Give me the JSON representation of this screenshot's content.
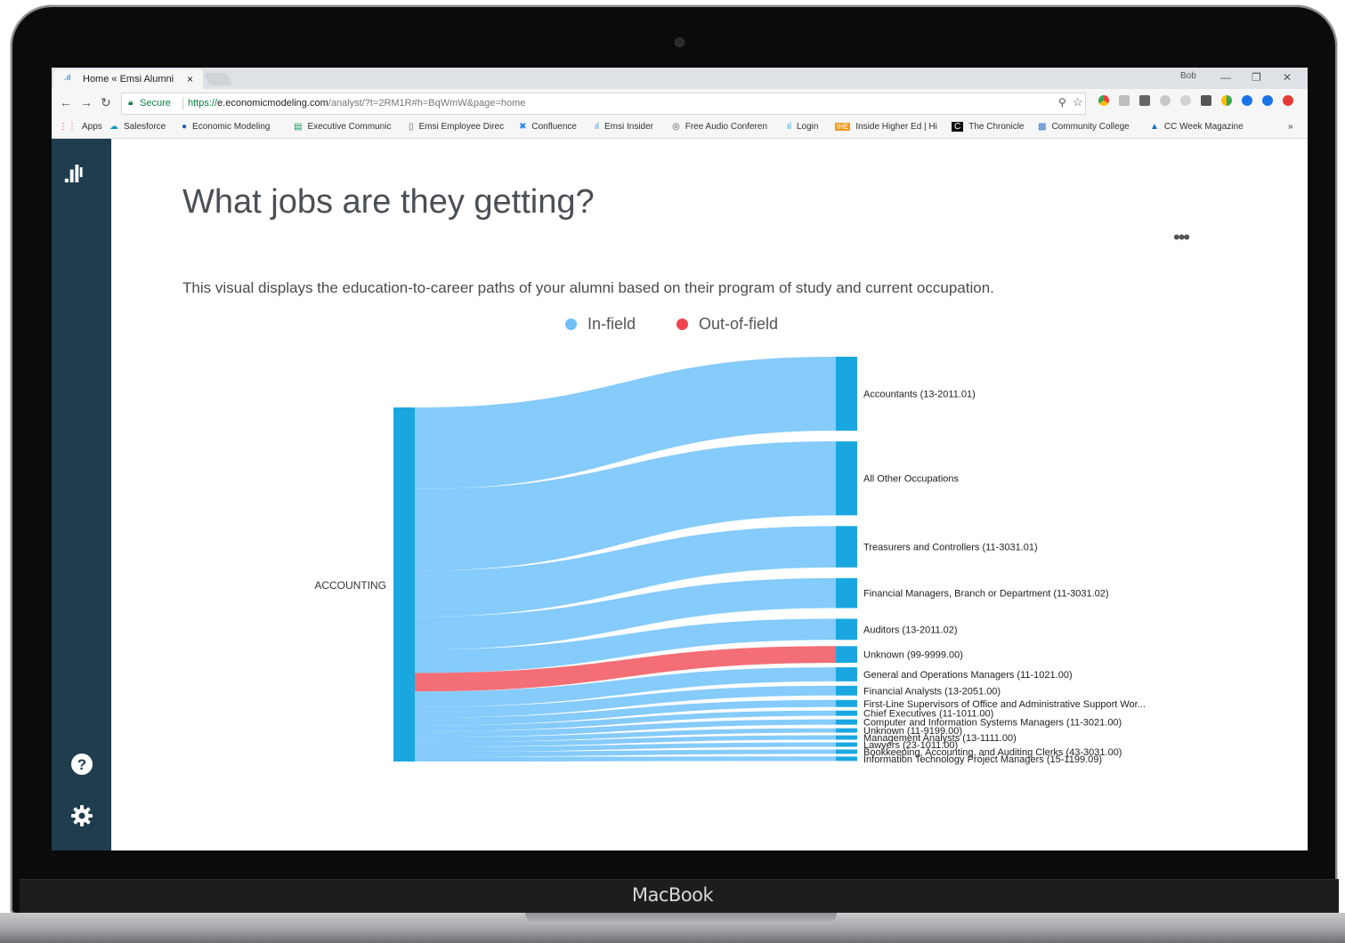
{
  "device": {
    "brand": "MacBook"
  },
  "browser": {
    "tab_title": "Home « Emsi Alumni",
    "tab_close": "×",
    "profile": "Bob",
    "window_controls": [
      "—",
      "❐",
      "✕"
    ],
    "secure_label": "Secure",
    "url_scheme": "https://",
    "url_host": "e.economicmodeling.com",
    "url_path": "/analyst/?t=2RM1R#h=BqWmW&page=home",
    "bookmarks": [
      {
        "label": "Apps",
        "icon": "apps-icon"
      },
      {
        "label": "Salesforce",
        "icon": "salesforce-icon"
      },
      {
        "label": "Economic Modeling",
        "icon": "economic-modeling-icon"
      },
      {
        "label": "Executive Communic",
        "icon": "sheets-icon"
      },
      {
        "label": "Emsi Employee Direc",
        "icon": "page-icon"
      },
      {
        "label": "Confluence",
        "icon": "confluence-icon"
      },
      {
        "label": "Emsi Insider",
        "icon": "emsi-icon"
      },
      {
        "label": "Free Audio Conferen",
        "icon": "audio-icon"
      },
      {
        "label": "Login",
        "icon": "emsi-icon"
      },
      {
        "label": "Inside Higher Ed | Hi",
        "icon": "ihe-icon"
      },
      {
        "label": "The Chronicle",
        "icon": "chronicle-icon"
      },
      {
        "label": "Community College",
        "icon": "cc-icon"
      },
      {
        "label": "CC Week Magazine",
        "icon": "magazine-icon"
      }
    ],
    "bookmarks_overflow": "»"
  },
  "page": {
    "title": "What jobs are they getting?",
    "description": "This visual displays the education-to-career paths of your alumni based on their program of study and current occupation.",
    "more_menu": "•••"
  },
  "colors": {
    "in_field": "#7ec8fb",
    "out_field": "#f2666f",
    "node": "#1aa7e0",
    "sidebar": "#1f3d4c"
  },
  "chart_data": {
    "type": "sankey",
    "legend": [
      {
        "name": "In-field",
        "color": "#6ec0f5"
      },
      {
        "name": "Out-of-field",
        "color": "#ef4450"
      }
    ],
    "source": "ACCOUNTING",
    "targets": [
      {
        "label": "Accountants (13-2011.01)",
        "value": 84,
        "field": "in"
      },
      {
        "label": "All Other Occupations",
        "value": 84,
        "field": "in"
      },
      {
        "label": "Treasurers and Controllers (11-3031.01)",
        "value": 47,
        "field": "in"
      },
      {
        "label": "Financial Managers, Branch or Department (11-3031.02)",
        "value": 34,
        "field": "in"
      },
      {
        "label": "Auditors (13-2011.02)",
        "value": 24,
        "field": "in"
      },
      {
        "label": "Unknown (99-9999.00)",
        "value": 19,
        "field": "out"
      },
      {
        "label": "General and Operations Managers (11-1021.00)",
        "value": 16,
        "field": "in"
      },
      {
        "label": "Financial Analysts (13-2051.00)",
        "value": 11,
        "field": "in"
      },
      {
        "label": "First-Line Supervisors of Office and Administrative Support Wor...",
        "value": 8,
        "field": "in"
      },
      {
        "label": "Chief Executives (11-1011.00)",
        "value": 6,
        "field": "in"
      },
      {
        "label": "Computer and Information Systems Managers (11-3021.00)",
        "value": 6,
        "field": "in"
      },
      {
        "label": "Unknown (11-9199.00)",
        "value": 5,
        "field": "in"
      },
      {
        "label": "Management Analysts (13-1111.00)",
        "value": 5,
        "field": "in"
      },
      {
        "label": "Lawyers (23-1011.00)",
        "value": 5,
        "field": "in"
      },
      {
        "label": "Bookkeeping, Accounting, and Auditing Clerks (43-3031.00)",
        "value": 5,
        "field": "in"
      },
      {
        "label": "Information Technology Project Managers (15-1199.09)",
        "value": 5,
        "field": "in"
      }
    ]
  }
}
